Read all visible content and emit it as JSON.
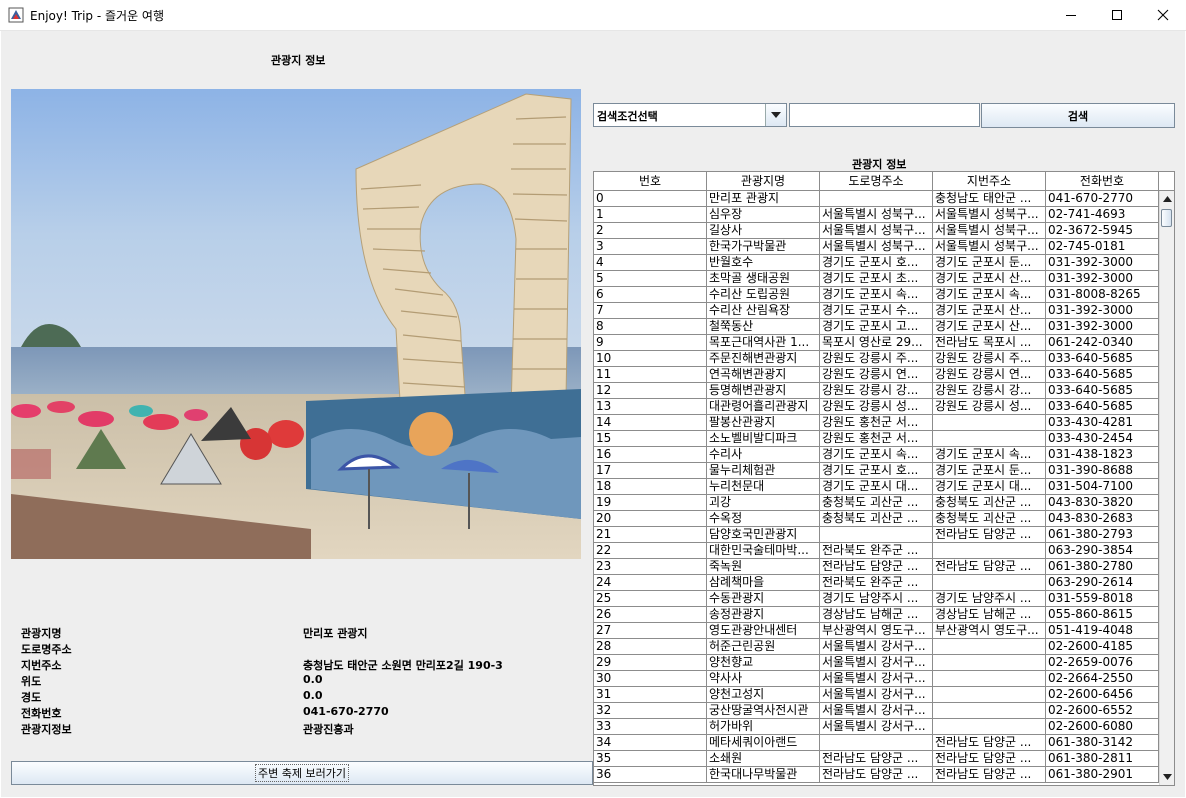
{
  "window": {
    "title": "Enjoy! Trip - 즐거운 여행"
  },
  "left_panel": {
    "heading": "관광지 정보",
    "info": {
      "labels": [
        "관광지명",
        "도로명주소",
        "지번주소",
        "위도",
        "경도",
        "전화번호",
        "관광지정보"
      ],
      "values": [
        "만리포 관광지",
        "",
        "충청남도 태안군 소원면 만리포2길 190-3",
        "0.0",
        "0.0",
        "041-670-2770",
        "관광진흥과"
      ]
    },
    "festival_button": "주변 축제 보러가기"
  },
  "search": {
    "combo_selected": "검색조건선택",
    "input_value": "",
    "button_label": "검색"
  },
  "table": {
    "title": "관광지 정보",
    "columns": [
      "번호",
      "관광지명",
      "도로명주소",
      "지번주소",
      "전화번호"
    ],
    "rows": [
      [
        "0",
        "만리포 관광지",
        "",
        "충청남도 태안군 ...",
        "041-670-2770"
      ],
      [
        "1",
        "심우장",
        "서울특별시 성북구...",
        "서울특별시 성북구...",
        "02-741-4693"
      ],
      [
        "2",
        "길상사",
        "서울특별시 성북구...",
        "서울특별시 성북구...",
        "02-3672-5945"
      ],
      [
        "3",
        "한국가구박물관",
        "서울특별시 성북구...",
        "서울특별시 성북구...",
        "02-745-0181"
      ],
      [
        "4",
        "반월호수",
        "경기도 군포시 호...",
        "경기도 군포시 둔...",
        "031-392-3000"
      ],
      [
        "5",
        "초막골 생태공원",
        "경기도 군포시 초...",
        "경기도 군포시 산...",
        "031-392-3000"
      ],
      [
        "6",
        "수리산 도립공원",
        "경기도 군포시 속...",
        "경기도 군포시 속...",
        "031-8008-8265"
      ],
      [
        "7",
        "수리산 산림욕장",
        "경기도 군포시 수...",
        "경기도 군포시 산...",
        "031-392-3000"
      ],
      [
        "8",
        "철쭉동산",
        "경기도 군포시 고...",
        "경기도 군포시 산...",
        "031-392-3000"
      ],
      [
        "9",
        "목포근대역사관 1...",
        "목포시 영산로 29...",
        "전라남도 목포시 ...",
        "061-242-0340"
      ],
      [
        "10",
        "주문진해변관광지",
        "강원도 강릉시 주...",
        "강원도 강릉시 주...",
        "033-640-5685"
      ],
      [
        "11",
        "연곡해변관광지",
        "강원도 강릉시 연...",
        "강원도 강릉시 연...",
        "033-640-5685"
      ],
      [
        "12",
        "등명해변관광지",
        "강원도 강릉시 강...",
        "강원도 강릉시 강...",
        "033-640-5685"
      ],
      [
        "13",
        "대관령어흘리관광지",
        "강원도 강릉시 성...",
        "강원도 강릉시 성...",
        "033-640-5685"
      ],
      [
        "14",
        "팔봉산관광지",
        "강원도 홍천군 서...",
        "",
        "033-430-4281"
      ],
      [
        "15",
        "소노벨비발디파크",
        "강원도 홍천군 서...",
        "",
        "033-430-2454"
      ],
      [
        "16",
        "수리사",
        "경기도 군포시 속...",
        "경기도 군포시 속...",
        "031-438-1823"
      ],
      [
        "17",
        "물누리체험관",
        "경기도 군포시 호...",
        "경기도 군포시 둔...",
        "031-390-8688"
      ],
      [
        "18",
        "누리천문대",
        "경기도 군포시 대...",
        "경기도 군포시 대...",
        "031-504-7100"
      ],
      [
        "19",
        "괴강",
        "충청북도 괴산군 ...",
        "충청북도 괴산군 ...",
        "043-830-3820"
      ],
      [
        "20",
        "수옥정",
        "충청북도 괴산군 ...",
        "충청북도 괴산군 ...",
        "043-830-2683"
      ],
      [
        "21",
        "담양호국민관광지",
        "",
        "전라남도 담양군 ...",
        "061-380-2793"
      ],
      [
        "22",
        "대한민국술테마박...",
        "전라북도 완주군 ...",
        "",
        "063-290-3854"
      ],
      [
        "23",
        "죽녹원",
        "전라남도 담양군 ...",
        "전라남도 담양군 ...",
        "061-380-2780"
      ],
      [
        "24",
        "삼례책마을",
        "전라북도 완주군 ...",
        "",
        "063-290-2614"
      ],
      [
        "25",
        "수동관광지",
        "경기도 남양주시 ...",
        "경기도 남양주시 ...",
        "031-559-8018"
      ],
      [
        "26",
        "송정관광지",
        "경상남도 남해군 ...",
        "경상남도 남해군 ...",
        "055-860-8615"
      ],
      [
        "27",
        "영도관광안내센터",
        "부산광역시 영도구...",
        "부산광역시 영도구...",
        "051-419-4048"
      ],
      [
        "28",
        "허준근린공원",
        "서울특별시 강서구...",
        "",
        "02-2600-4185"
      ],
      [
        "29",
        "양천향교",
        "서울특별시 강서구...",
        "",
        "02-2659-0076"
      ],
      [
        "30",
        "약사사",
        "서울특별시 강서구...",
        "",
        "02-2664-2550"
      ],
      [
        "31",
        "양천고성지",
        "서울특별시 강서구...",
        "",
        "02-2600-6456"
      ],
      [
        "32",
        "궁산땅굴역사전시관",
        "서울특별시 강서구...",
        "",
        "02-2600-6552"
      ],
      [
        "33",
        "허가바위",
        "서울특별시 강서구...",
        "",
        "02-2600-6080"
      ],
      [
        "34",
        "메타세쿼이아랜드",
        "",
        "전라남도 담양군 ...",
        "061-380-3142"
      ],
      [
        "35",
        "소쇄원",
        "전라남도 담양군 ...",
        "전라남도 담양군 ...",
        "061-380-2811"
      ],
      [
        "36",
        "한국대나무박물관",
        "전라남도 담양군 ...",
        "전라남도 담양군 ...",
        "061-380-2901"
      ]
    ]
  },
  "icons": {
    "app": "java-cup-icon",
    "minimize": "minimize-icon",
    "maximize": "maximize-icon",
    "close": "close-icon",
    "combo": "chevron-down-icon"
  },
  "colors": {
    "panel_bg": "#eeeeee",
    "button_border": "#7a8a99",
    "grid_line": "#8c8c8c"
  }
}
